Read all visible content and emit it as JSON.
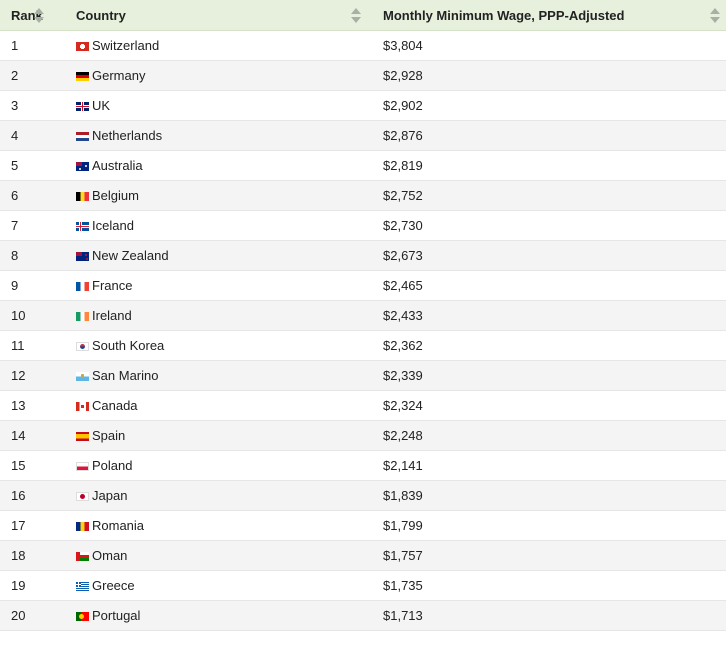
{
  "table": {
    "headers": [
      "Rank",
      "Country",
      "Monthly Minimum Wage, PPP-Adjusted"
    ]
  },
  "chart_data": {
    "type": "table",
    "columns": [
      "Rank",
      "Country",
      "Monthly Minimum Wage, PPP-Adjusted"
    ],
    "rows": [
      {
        "rank": "1",
        "country": "Switzerland",
        "wage": "$3,804",
        "flag": "ch"
      },
      {
        "rank": "2",
        "country": "Germany",
        "wage": "$2,928",
        "flag": "de"
      },
      {
        "rank": "3",
        "country": "UK",
        "wage": "$2,902",
        "flag": "uk"
      },
      {
        "rank": "4",
        "country": "Netherlands",
        "wage": "$2,876",
        "flag": "nl"
      },
      {
        "rank": "5",
        "country": "Australia",
        "wage": "$2,819",
        "flag": "au"
      },
      {
        "rank": "6",
        "country": "Belgium",
        "wage": "$2,752",
        "flag": "be"
      },
      {
        "rank": "7",
        "country": "Iceland",
        "wage": "$2,730",
        "flag": "is"
      },
      {
        "rank": "8",
        "country": "New Zealand",
        "wage": "$2,673",
        "flag": "nz"
      },
      {
        "rank": "9",
        "country": "France",
        "wage": "$2,465",
        "flag": "fr"
      },
      {
        "rank": "10",
        "country": "Ireland",
        "wage": "$2,433",
        "flag": "ie"
      },
      {
        "rank": "11",
        "country": "South Korea",
        "wage": "$2,362",
        "flag": "kr"
      },
      {
        "rank": "12",
        "country": "San Marino",
        "wage": "$2,339",
        "flag": "sm"
      },
      {
        "rank": "13",
        "country": "Canada",
        "wage": "$2,324",
        "flag": "ca"
      },
      {
        "rank": "14",
        "country": "Spain",
        "wage": "$2,248",
        "flag": "es"
      },
      {
        "rank": "15",
        "country": "Poland",
        "wage": "$2,141",
        "flag": "pl"
      },
      {
        "rank": "16",
        "country": "Japan",
        "wage": "$1,839",
        "flag": "jp"
      },
      {
        "rank": "17",
        "country": "Romania",
        "wage": "$1,799",
        "flag": "ro"
      },
      {
        "rank": "18",
        "country": "Oman",
        "wage": "$1,757",
        "flag": "om"
      },
      {
        "rank": "19",
        "country": "Greece",
        "wage": "$1,735",
        "flag": "gr"
      },
      {
        "rank": "20",
        "country": "Portugal",
        "wage": "$1,713",
        "flag": "pt"
      }
    ]
  }
}
